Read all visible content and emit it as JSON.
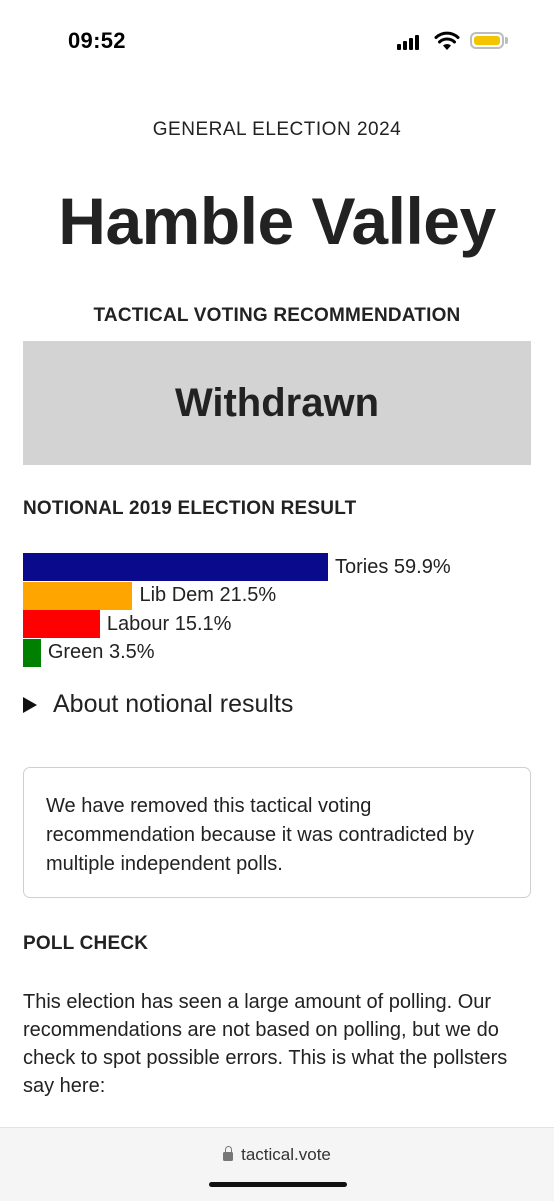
{
  "status_bar": {
    "time": "09:52",
    "battery_color": "#f2c500"
  },
  "page": {
    "eyebrow": "GENERAL ELECTION 2024",
    "title": "Hamble Valley",
    "recommendation_heading": "TACTICAL VOTING RECOMMENDATION",
    "recommendation": "Withdrawn",
    "result_heading": "NOTIONAL 2019 ELECTION RESULT",
    "about_label": "About notional results",
    "notice": "We have removed this tactical voting recommendation because it was contradicted by multiple independent polls.",
    "poll_check_heading": "POLL CHECK",
    "poll_check_text": "This election has seen a large amount of polling. Our recommendations are not based on polling, but we do check to spot possible errors. This is what the pollsters say here:"
  },
  "chart_data": {
    "type": "bar",
    "orientation": "horizontal",
    "categories": [
      "Tories",
      "Lib Dem",
      "Labour",
      "Green"
    ],
    "values": [
      59.9,
      21.5,
      15.1,
      3.5
    ],
    "labels": [
      "Tories 59.9%",
      "Lib Dem 21.5%",
      "Labour 15.1%",
      "Green 3.5%"
    ],
    "colors": [
      "#0a0a8c",
      "#ffa500",
      "#ff0000",
      "#008000"
    ],
    "unit": "%"
  },
  "browser": {
    "url": "tactical.vote"
  }
}
